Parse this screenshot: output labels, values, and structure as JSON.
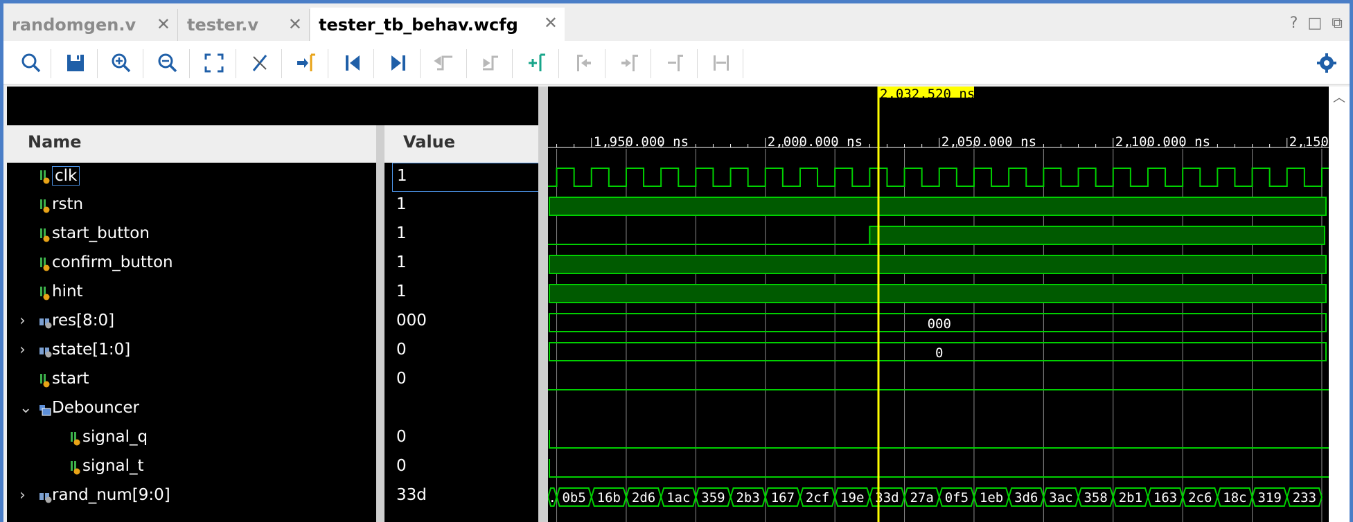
{
  "tabs": [
    {
      "label": "randomgen.v",
      "active": false
    },
    {
      "label": "tester.v",
      "active": false
    },
    {
      "label": "tester_tb_behav.wcfg",
      "active": true
    }
  ],
  "window_controls": [
    "?",
    "□",
    "⧉"
  ],
  "toolbar": {
    "buttons": [
      "search",
      "save",
      "zoom-in",
      "zoom-out",
      "zoom-fit",
      "cursor-snap",
      "go-to-cursor",
      "go-to-time-0",
      "go-to-last-time",
      "previous-transition",
      "next-transition",
      "add-marker",
      "previous-marker",
      "next-marker",
      "swap-cursors",
      "cursor-delta",
      "settings"
    ]
  },
  "columns": {
    "name": "Name",
    "value": "Value"
  },
  "cursor": {
    "label": "2,032.520 ns",
    "time_ns": 2032.52
  },
  "timeline": {
    "labels": [
      "1,950.000 ns",
      "2,000.000 ns",
      "2,050.000 ns",
      "2,100.000 ns",
      "2,150"
    ],
    "range_ns": [
      1937.5,
      2162.0
    ]
  },
  "signals": [
    {
      "name": "clk",
      "value": "1",
      "kind": "bit",
      "expandable": false,
      "selected": true
    },
    {
      "name": "rstn",
      "value": "1",
      "kind": "bit",
      "expandable": false
    },
    {
      "name": "start_button",
      "value": "1",
      "kind": "bit",
      "expandable": false
    },
    {
      "name": "confirm_button",
      "value": "1",
      "kind": "bit",
      "expandable": false
    },
    {
      "name": "hint",
      "value": "1",
      "kind": "bit",
      "expandable": false
    },
    {
      "name": "res[8:0]",
      "value": "000",
      "kind": "bus",
      "expandable": true
    },
    {
      "name": "state[1:0]",
      "value": "0",
      "kind": "bus",
      "expandable": true
    },
    {
      "name": "start",
      "value": "0",
      "kind": "bit",
      "expandable": false
    },
    {
      "name": "Debouncer",
      "value": "",
      "kind": "group",
      "expanded": true
    },
    {
      "name": "signal_q",
      "value": "0",
      "kind": "bit",
      "indent": true
    },
    {
      "name": "signal_t",
      "value": "0",
      "kind": "bit",
      "indent": true
    },
    {
      "name": "rand_num[9:0]",
      "value": "33d",
      "kind": "bus",
      "expandable": true
    }
  ],
  "waves": {
    "res_value": "000",
    "state_value": "0",
    "rand_num_values": [
      ".",
      "0b5",
      "16b",
      "2d6",
      "1ac",
      "359",
      "2b3",
      "167",
      "2cf",
      "19e",
      "33d",
      "27a",
      "0f5",
      "1eb",
      "3d6",
      "3ac",
      "358",
      "2b1",
      "163",
      "2c6",
      "18c",
      "319",
      "233"
    ]
  },
  "colors": {
    "wave": "#00d000",
    "wave_fill": "#005a00",
    "cursor": "#ffff00",
    "grid": "#ffffff"
  }
}
